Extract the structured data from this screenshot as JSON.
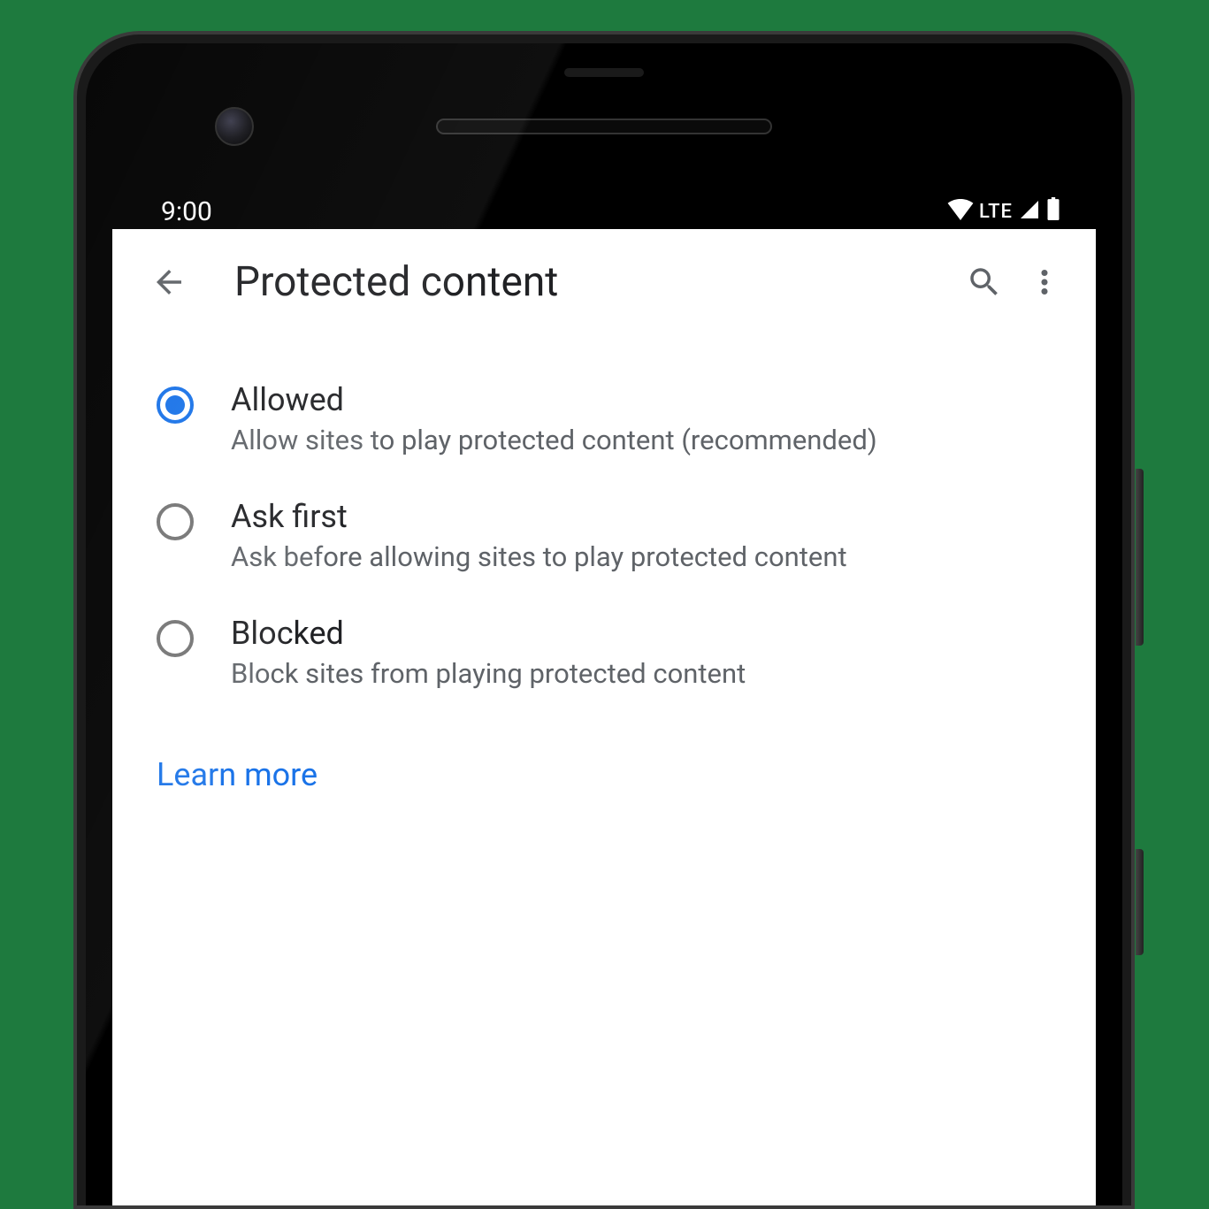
{
  "status_bar": {
    "time": "9:00",
    "network_label": "LTE"
  },
  "header": {
    "title": "Protected content"
  },
  "options": [
    {
      "title": "Allowed",
      "description": "Allow sites to play protected content (recommended)",
      "selected": true
    },
    {
      "title": "Ask first",
      "description": "Ask before allowing sites to play protected content",
      "selected": false
    },
    {
      "title": "Blocked",
      "description": "Block sites from playing protected content",
      "selected": false
    }
  ],
  "footer": {
    "learn_more": "Learn more"
  },
  "colors": {
    "accent": "#1a73e8"
  }
}
